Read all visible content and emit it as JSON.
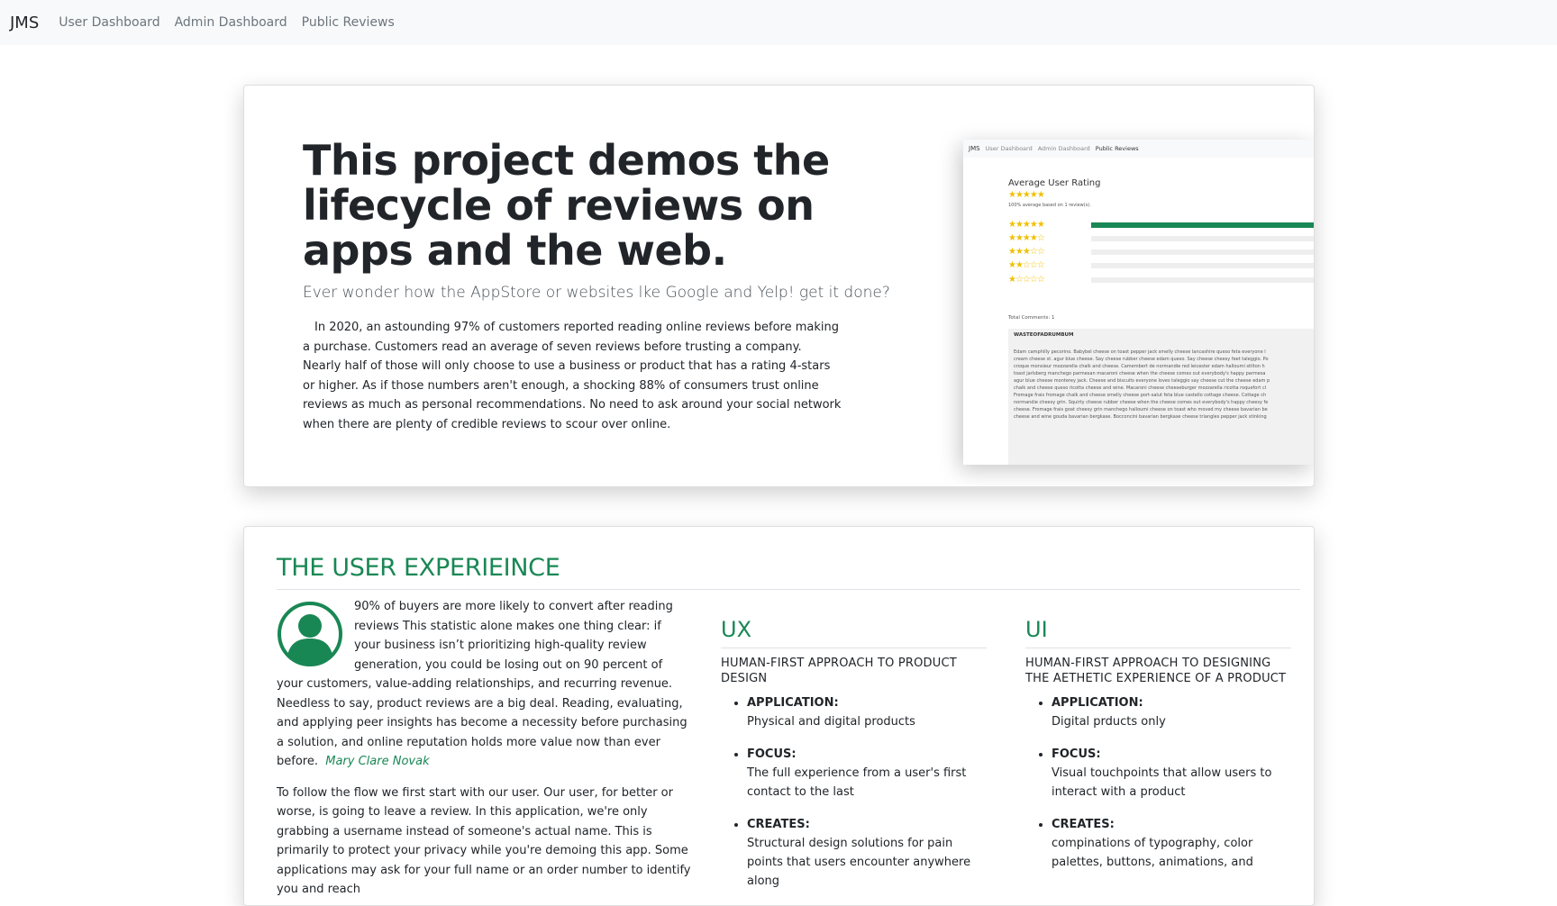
{
  "nav": {
    "brand": "JMS",
    "links": [
      "User Dashboard",
      "Admin Dashboard",
      "Public Reviews"
    ]
  },
  "hero": {
    "title": "This project demos the lifecycle of reviews on apps and the web.",
    "lead": "Ever wonder how the AppStore or websites lke Google and Yelp! get it done?",
    "body": "In 2020, an astounding 97% of customers reported reading online reviews before making a purchase. Customers read an average of seven reviews before trusting a company. Nearly half of those will only choose to use a business or product that has a rating 4-stars or higher. As if those numbers aren't enough, a shocking 88% of consumers trust online reviews as much as personal recommendations. No need to ask around your social network when there are plenty of credible reviews to scour over online."
  },
  "screenshot": {
    "nav_brand": "JMS",
    "nav_links": [
      "User Dashboard",
      "Admin Dashboard",
      "Public Reviews"
    ],
    "title": "Average User Rating",
    "stars": "★★★★★",
    "subtitle": "100% average based on 1 review(s).",
    "rows": [
      {
        "stars": "★★★★★",
        "fill": 1.0
      },
      {
        "stars": "★★★★☆",
        "fill": 0
      },
      {
        "stars": "★★★☆☆",
        "fill": 0
      },
      {
        "stars": "★★☆☆☆",
        "fill": 0
      },
      {
        "stars": "★☆☆☆☆",
        "fill": 0
      }
    ],
    "total": "Total Comments: 1",
    "comment_user": "WASTEOFADRUMBUM",
    "comment_lines": [
      "Edam camphilly pecorino. Babybel cheese on toast pepper jack smelly cheese lancashire queso feta everyone l",
      "cream cheese st. agur blue cheese. Say cheese rubber cheese edam queso. Say cheese cheesy feet taleggio. Po",
      "croque monsieur mozzarella chalk and cheese. Camembert de normandie red leicester edam halloumi stilton h",
      "toast jarlsberg manchego parmesan macaroni cheese when the cheese comes out everybody's happy parmesa",
      "agur blue cheese monterey jack. Cheese and biscuits everyone loves taleggio say cheese cut the cheese edam p",
      "chalk and cheese queso ricotta cheese and wine. Macaroni cheese cheeseburger mozzarella ricotta roquefort cl",
      "Fromage frais fromage chalk and cheese smelly cheese port-salut feta blue castello cottage cheese. Cottage ch",
      "normandie cheesy grin. Squirty cheese rubber cheese when the cheese comes out everybody's happy cheesy fe",
      "cheese. Fromage frais goat cheesy grin manchego halloumi cheese on toast who moved my cheese bavarian be",
      "cheese and wine gouda bavarian bergkase. Bocconcini bavarian bergkase cheese triangles pepper jack stinking"
    ]
  },
  "ux_section": {
    "heading": "THE USER EXPERIEINCE",
    "quote": "90% of buyers are more likely to convert after reading reviews This statistic alone makes one thing clear: if your business isn’t prioritizing high-quality review generation, you could be losing out on 90 percent of your customers, value-adding relationships, and recurring revenue. Needless to say, product reviews are a big deal. Reading, evaluating, and applying peer insights has become a necessity before purchasing a solution, and online reputation holds more value now than ever before.",
    "author": "Mary Clare Novak",
    "paragraph2": "To follow the flow we first start with our user. Our user, for better or worse, is going to leave a review. In this application, we're only grabbing a username instead of someone's actual name. This is primarily to protect your privacy while you're demoing this app. Some applications may ask for your full name or an order number to identify you and reach"
  },
  "ux_col": {
    "title": "UX",
    "subtitle": "HUMAN-FIRST APPROACH TO PRODUCT DESIGN",
    "items": [
      {
        "label": "APPLICATION:",
        "text": "Physical and digital products"
      },
      {
        "label": "FOCUS:",
        "text": "The full experience from a user's first contact to the last"
      },
      {
        "label": "CREATES:",
        "text": "Structural design solutions for pain points that users encounter anywhere along"
      }
    ]
  },
  "ui_col": {
    "title": "UI",
    "subtitle": "HUMAN-FIRST APPROACH TO DESIGNING THE AETHETIC EXPERIENCE OF A PRODUCT",
    "items": [
      {
        "label": "APPLICATION:",
        "text": "Digital prducts only"
      },
      {
        "label": "FOCUS:",
        "text": "Visual touchpoints that allow users to interact with a product"
      },
      {
        "label": "CREATES:",
        "text": "compinations of typography, color palettes, buttons, animations, and"
      }
    ]
  },
  "colors": {
    "accent": "#198754",
    "navbar_bg": "#f8f9fa",
    "star": "#f0c000"
  }
}
